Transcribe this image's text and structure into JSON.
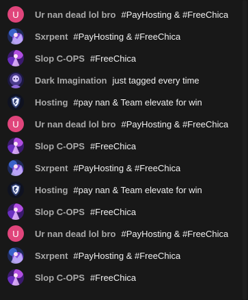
{
  "chat": {
    "messages": [
      {
        "avatar": "letter",
        "avatar_letter": "U",
        "author": "Ur nan dead lol bro",
        "message": "#PayHosting & #FreeChica"
      },
      {
        "avatar": "anime-character-blue",
        "author": "Sxrpent",
        "message": "#PayHosting & #FreeChica"
      },
      {
        "avatar": "anime-character-purple",
        "author": "Slop C-OPS",
        "message": "#FreeChica"
      },
      {
        "avatar": "dark-character",
        "author": "Dark Imagination",
        "message": "just tagged every time"
      },
      {
        "avatar": "shield-logo",
        "author": "Hosting",
        "message": "#pay nan & Team elevate for win"
      },
      {
        "avatar": "letter",
        "avatar_letter": "U",
        "author": "Ur nan dead lol bro",
        "message": "#PayHosting & #FreeChica"
      },
      {
        "avatar": "anime-character-purple",
        "author": "Slop C-OPS",
        "message": "#FreeChica"
      },
      {
        "avatar": "anime-character-blue",
        "author": "Sxrpent",
        "message": "#PayHosting & #FreeChica"
      },
      {
        "avatar": "shield-logo",
        "author": "Hosting",
        "message": "#pay nan & Team elevate for win"
      },
      {
        "avatar": "anime-character-purple",
        "author": "Slop C-OPS",
        "message": "#FreeChica"
      },
      {
        "avatar": "letter",
        "avatar_letter": "U",
        "author": "Ur nan dead lol bro",
        "message": "#PayHosting & #FreeChica"
      },
      {
        "avatar": "anime-character-blue",
        "author": "Sxrpent",
        "message": "#PayHosting & #FreeChica"
      },
      {
        "avatar": "anime-character-purple",
        "author": "Slop C-OPS",
        "message": "#FreeChica"
      }
    ]
  },
  "colors": {
    "background": "#181818",
    "author": "#aaaaaa",
    "message": "#f1f1f1",
    "letter_avatar": "#e0457b"
  }
}
